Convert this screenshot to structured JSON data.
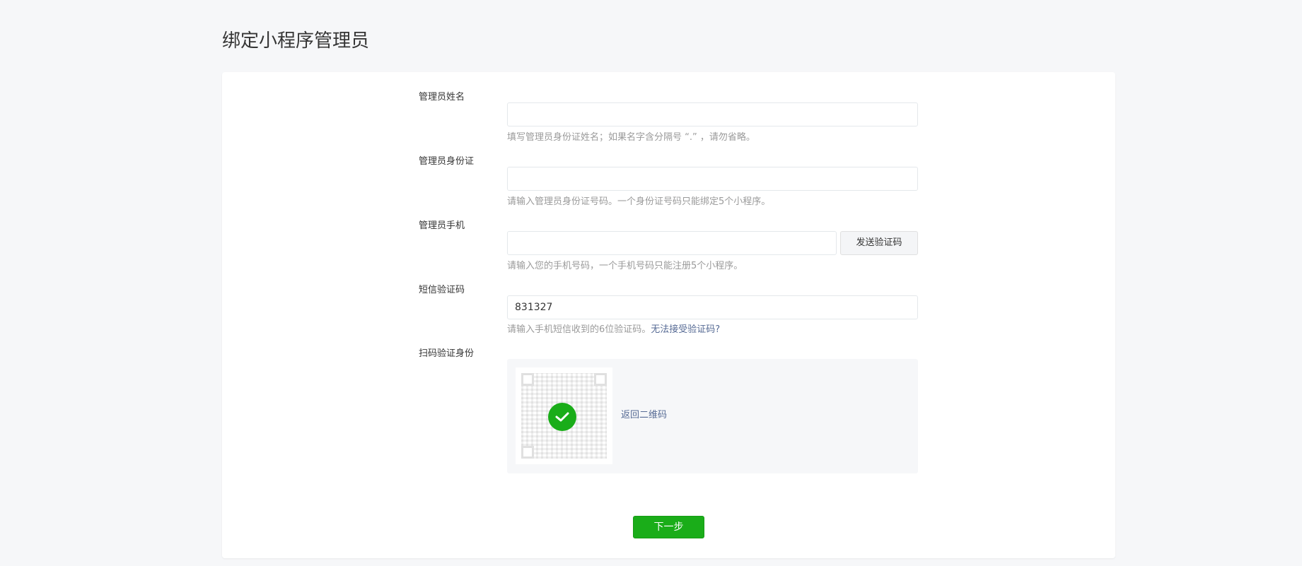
{
  "page": {
    "title": "绑定小程序管理员"
  },
  "form": {
    "name": {
      "label": "管理员姓名",
      "value": "",
      "hint": "填写管理员身份证姓名；如果名字含分隔号 “.” ，请勿省略。"
    },
    "id_card": {
      "label": "管理员身份证",
      "value": "",
      "hint": "请输入管理员身份证号码。一个身份证号码只能绑定5个小程序。"
    },
    "phone": {
      "label": "管理员手机",
      "value": "",
      "send_code_label": "发送验证码",
      "hint": "请输入您的手机号码，一个手机号码只能注册5个小程序。"
    },
    "sms_code": {
      "label": "短信验证码",
      "value": "831327",
      "hint": "请输入手机短信收到的6位验证码。",
      "hint_link": "无法接受验证码?"
    },
    "scan": {
      "label": "扫码验证身份",
      "status_icon": "check-circle-icon",
      "back_link": "返回二维码"
    },
    "next_label": "下一步"
  },
  "colors": {
    "accent": "#1aad19",
    "link": "#576b95",
    "hint": "#9a9a9a",
    "background": "#f6f7f9"
  }
}
